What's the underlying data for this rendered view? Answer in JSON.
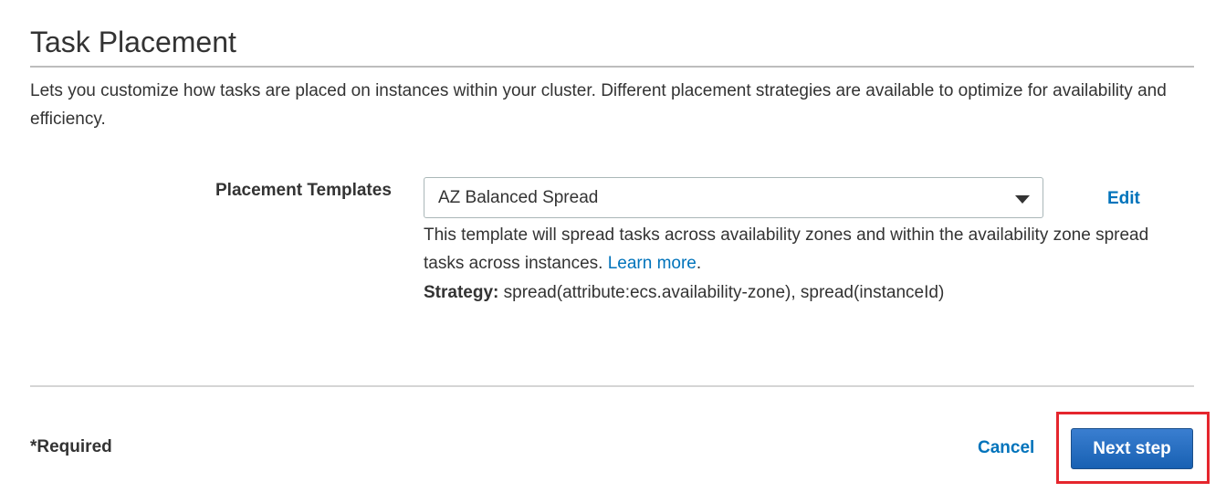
{
  "section": {
    "title": "Task Placement",
    "description": "Lets you customize how tasks are placed on instances within your cluster. Different placement strategies are available to optimize for availability and efficiency."
  },
  "placement": {
    "label": "Placement Templates",
    "selected_value": "AZ Balanced Spread",
    "edit_label": "Edit",
    "help_text": "This template will spread tasks across availability zones and within the availability zone spread tasks across instances.",
    "learn_more_label": "Learn more",
    "learn_more_suffix": ".",
    "strategy_label": "Strategy:",
    "strategy_value": "spread(attribute:ecs.availability-zone), spread(instanceId)"
  },
  "footer": {
    "required_note": "*Required",
    "cancel_label": "Cancel",
    "next_label": "Next step"
  },
  "colors": {
    "link": "#0073bb",
    "primary_button": "#1861b3",
    "highlight": "#e5262d"
  },
  "icons": {
    "select_caret": "caret-down-icon"
  }
}
